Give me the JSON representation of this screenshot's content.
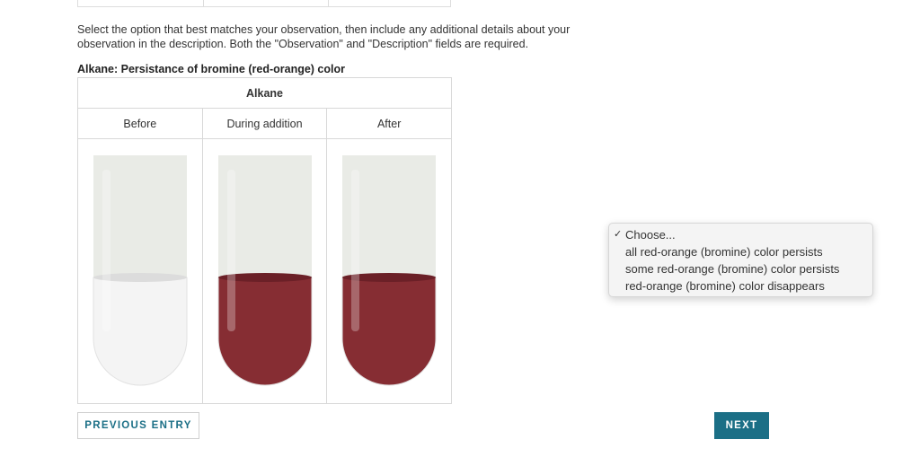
{
  "instructions": "Select the option that best matches your observation, then include any additional details about your observation in the description. Both the \"Observation\" and \"Description\" fields are required.",
  "table": {
    "title": "Alkane: Persistance of bromine (red-orange) color",
    "header": "Alkane",
    "columns": [
      "Before",
      "During addition",
      "After"
    ],
    "tubes": [
      {
        "liquid_color": "#f4f4f4",
        "meniscus_color": "#dcdcdc"
      },
      {
        "liquid_color": "#862d33",
        "meniscus_color": "#6b2027"
      },
      {
        "liquid_color": "#862d33",
        "meniscus_color": "#6b2027"
      }
    ],
    "glass_color": "#e9ebe6"
  },
  "dropdown": {
    "selected": "Choose...",
    "options": [
      "Choose...",
      "all red-orange (bromine) color persists",
      "some red-orange (bromine) color persists",
      "red-orange (bromine) color disappears"
    ],
    "check_icon": "checkmark-icon"
  },
  "buttons": {
    "previous": "PREVIOUS ENTRY",
    "next": "NEXT"
  },
  "colors": {
    "accent": "#1b6f86",
    "bromine": "#862d33"
  }
}
